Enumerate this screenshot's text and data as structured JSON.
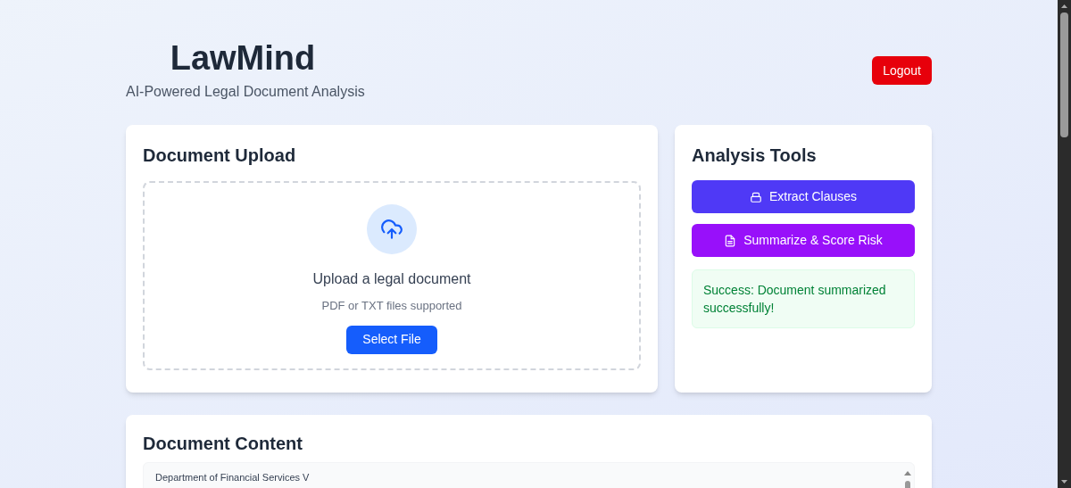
{
  "header": {
    "title": "LawMind",
    "subtitle": "AI-Powered Legal Document Analysis",
    "logout": "Logout"
  },
  "upload": {
    "title": "Document Upload",
    "prompt": "Upload a legal document",
    "hint": "PDF or TXT files supported",
    "button": "Select File"
  },
  "tools": {
    "title": "Analysis Tools",
    "buttons": [
      {
        "kind": "extract",
        "label": "Extract Clauses"
      },
      {
        "kind": "summarize",
        "label": "Summarize & Score Risk"
      }
    ],
    "message": {
      "kind": "success",
      "text": "Success: Document summarized successfully!"
    }
  },
  "content": {
    "title": "Document Content",
    "text": "Department of Financial Services V"
  }
}
